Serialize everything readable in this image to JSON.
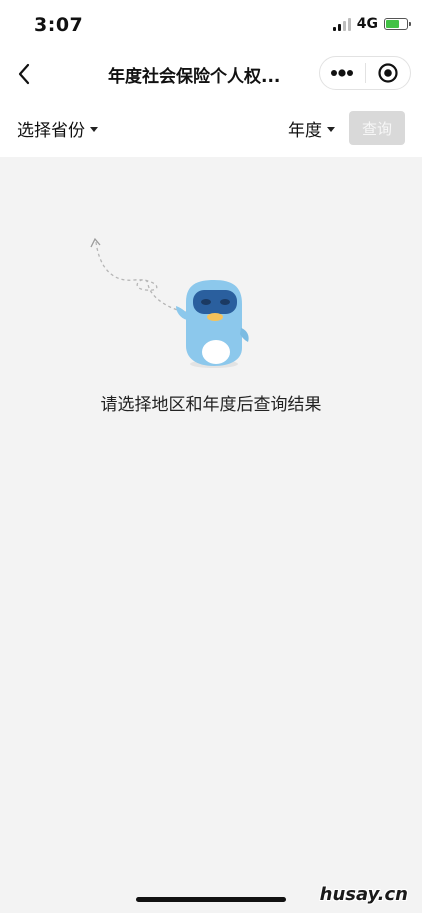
{
  "status_bar": {
    "time": "3:07",
    "network": "4G"
  },
  "nav": {
    "title": "年度社会保险个人权..."
  },
  "filters": {
    "province_label": "选择省份",
    "year_label": "年度",
    "query_label": "查询"
  },
  "empty_state": {
    "message": "请选择地区和年度后查询结果"
  },
  "watermark": {
    "text": "husay.cn"
  },
  "colors": {
    "background": "#f3f3f3",
    "header": "#ffffff",
    "query_disabled_bg": "#d9d9d9",
    "mascot_blue": "#8cc8ec",
    "mascot_mask": "#2a5f9e",
    "battery_green": "#41c144"
  }
}
